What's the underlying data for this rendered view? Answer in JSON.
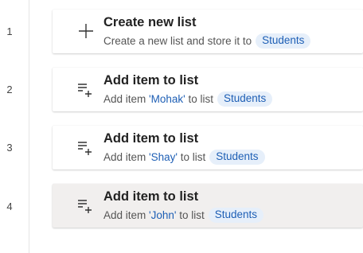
{
  "gutter": {
    "line_numbers": [
      "1",
      "2",
      "3",
      "4"
    ]
  },
  "actions": [
    {
      "title": "Create new list",
      "icon": "plus-icon",
      "desc_prefix": "Create a new list and store it to",
      "variable": "Students",
      "selected": false
    },
    {
      "title": "Add item to list",
      "icon": "add-item-list-icon",
      "desc_prefix": "Add item",
      "item_value": "'Mohak'",
      "desc_mid": "to list",
      "variable": "Students",
      "selected": false
    },
    {
      "title": "Add item to list",
      "icon": "add-item-list-icon",
      "desc_prefix": "Add item",
      "item_value": "'Shay'",
      "desc_mid": "to list",
      "variable": "Students",
      "selected": false
    },
    {
      "title": "Add item to list",
      "icon": "add-item-list-icon",
      "desc_prefix": "Add item",
      "item_value": "'John'",
      "desc_mid": "to list",
      "variable": "Students",
      "selected": true
    }
  ],
  "colors": {
    "variable_chip_bg": "#e6effa",
    "variable_chip_text": "#1e5fb5",
    "selected_row_bg": "#f1efee"
  }
}
